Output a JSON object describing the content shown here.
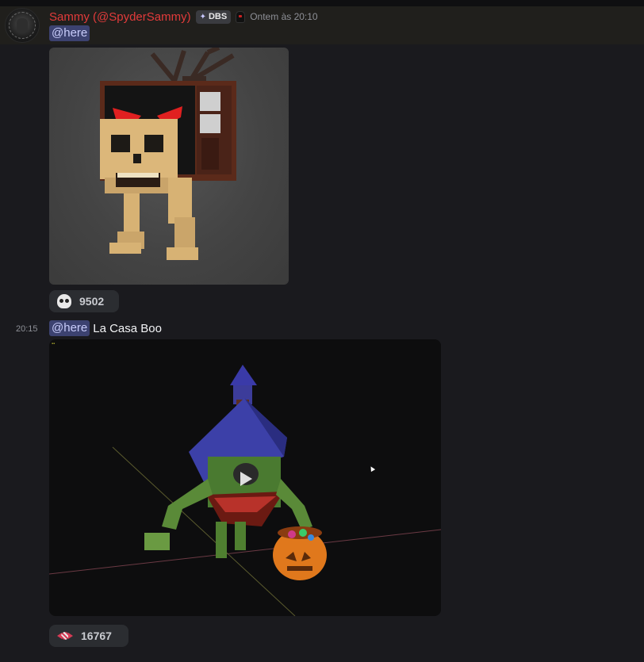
{
  "message1": {
    "author": "Sammy (@SpyderSammy)",
    "tag": "DBS",
    "timestamp": "Ontem às 20:10",
    "mention": "@here",
    "reaction": {
      "emoji": "skull-icon",
      "count": "9502"
    }
  },
  "message2": {
    "timestamp": "20:15",
    "mention": "@here",
    "text": "La Casa Boo",
    "reaction": {
      "emoji": "candy-icon",
      "count": "16767"
    }
  },
  "colors": {
    "author": "#e23b3b",
    "mention_bg": "#3c4270",
    "mention_text": "#c9cdfb",
    "reaction_bg": "#2b2d31",
    "background": "#1a1a1e"
  }
}
